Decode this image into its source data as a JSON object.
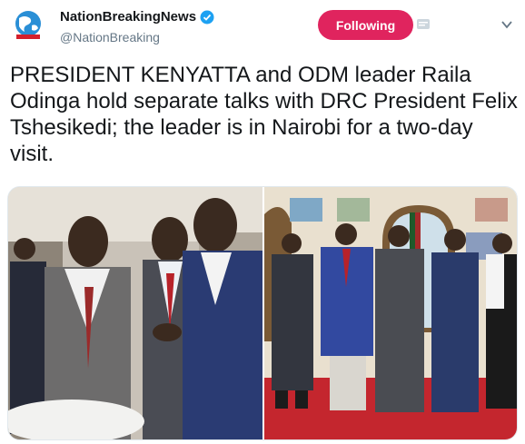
{
  "header": {
    "account_name": "NationBreakingNews",
    "handle": "@NationBreaking",
    "follow_label": "Following",
    "avatar_icon": "globe-logo-icon",
    "verified_icon": "verified-badge-icon",
    "menu_icon": "chevron-down-icon",
    "notification_icon": "notification-icon"
  },
  "tweet": {
    "text": "PRESIDENT KENYATTA and ODM leader Raila Odinga hold separate talks with DRC President Felix Tshesikedi; the leader is in Nairobi for a two-day visit."
  },
  "media": {
    "photos": [
      {
        "name": "handshake-photo",
        "alt": ""
      },
      {
        "name": "group-photo",
        "alt": ""
      }
    ]
  },
  "colors": {
    "follow_button": "#e0245e",
    "verified": "#1da1f2",
    "text": "#14171a",
    "secondary": "#657786"
  }
}
